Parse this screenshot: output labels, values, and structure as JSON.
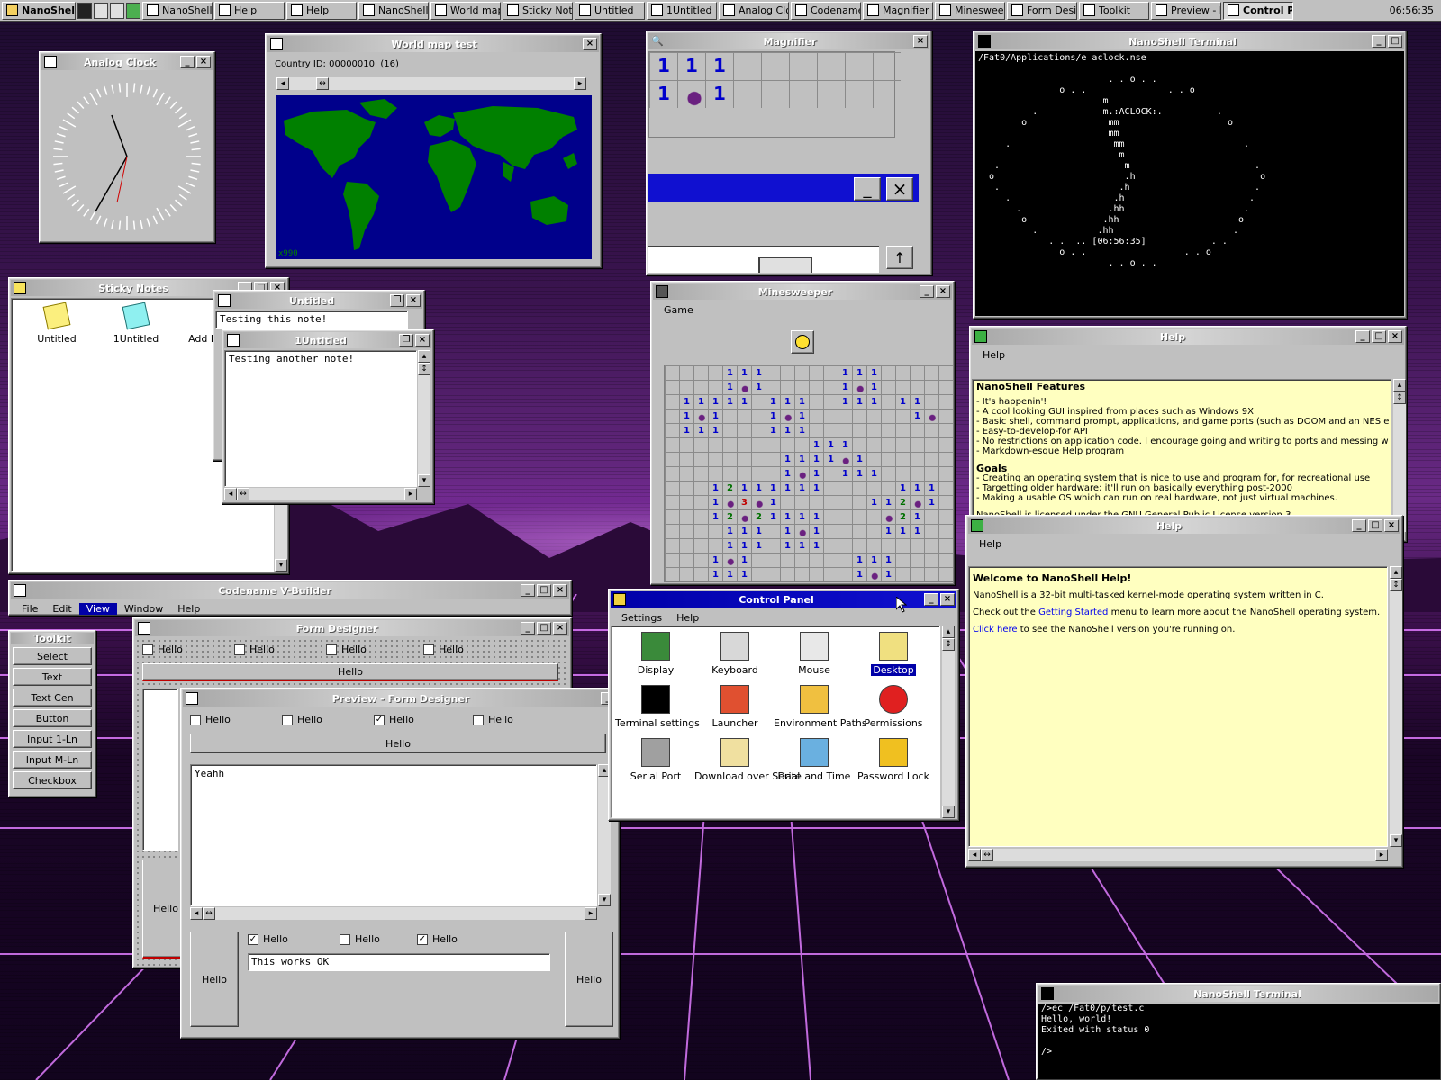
{
  "taskbar": {
    "start_label": "NanoShell",
    "buttons": [
      "NanoShell",
      "Help",
      "Help",
      "NanoShell",
      "World map",
      "Sticky Note",
      "Untitled",
      "1Untitled",
      "Analog Clo",
      "Codename",
      "Magnifier",
      "Minesweep",
      "Form Desig",
      "Toolkit",
      "Preview - F",
      "Control P"
    ],
    "clock": "06:56:35"
  },
  "analog_clock": {
    "title": "Analog Clock"
  },
  "world_map": {
    "title": "World map test",
    "country_id": "Country ID: 00000010  (16)",
    "corner_label": "x990"
  },
  "magnifier": {
    "title": "Magnifier",
    "cells": [
      "1",
      "1",
      "1",
      "1",
      "1"
    ]
  },
  "terminal1": {
    "title": "NanoShell Terminal",
    "lines": [
      "/Fat0/Applications/e aclock.nse",
      "",
      "                        . . o . .",
      "               o . .               . . o",
      "                       m",
      "          .            m.:ACLOCK:.          .",
      "        o               mm                    o",
      "                        mm",
      "     .                   mm                      .",
      "                          m",
      "   .                       m                       .",
      "  o                        .h                       o",
      "   .                      .h                       .",
      "     .                   .h                       .",
      "       .                .hh                      .",
      "        o              .hh                      o",
      "          .           .hh                      .",
      "             . .  .. [06:56:35]            . .",
      "               o . .                  . . o",
      "                        . . o . ."
    ]
  },
  "help1": {
    "title": "Help",
    "menu": "Help",
    "heading": "NanoShell Features",
    "features": [
      "- It's happenin'!",
      "- A cool looking GUI inspired from places such as Windows 9X",
      "- Basic shell, command prompt, applications, and game ports (such as DOOM and an NES e",
      "- Easy-to-develop-for API",
      "- No restrictions on application code.  I encourage going and writing to ports and messing w",
      "- Markdown-esque Help program"
    ],
    "goals_heading": "Goals",
    "goals": [
      "- Creating an operating system that is nice to use and program for, for recreational use",
      "- Targetting older hardware; it'll run on basically everything post-2000",
      "- Making a usable OS which can run on real hardware, not just virtual machines."
    ],
    "license": "NanoShell is licensed under the GNU General Public License version 3."
  },
  "help2": {
    "title": "Help",
    "menu": "Help",
    "heading": "Welcome to NanoShell Help!",
    "p1": "NanoShell is a 32-bit multi-tasked kernel-mode operating system written in C.",
    "p2_pre": "Check out the ",
    "p2_link": "Getting Started",
    "p2_post": " menu to learn more about the NanoShell operating system.",
    "p3_link": "Click here",
    "p3_post": " to see the NanoShell version you're running on."
  },
  "sticky": {
    "title": "Sticky Notes",
    "items": [
      "Untitled",
      "1Untitled",
      "Add Ne"
    ]
  },
  "note1": {
    "title": "Untitled",
    "text": "Testing this note!"
  },
  "note2": {
    "title": "1Untitled",
    "text": "Testing another note!"
  },
  "minesweeper": {
    "title": "Minesweeper",
    "menu": "Game"
  },
  "vbuilder": {
    "title": "Codename V-Builder",
    "menu": [
      "File",
      "Edit",
      "View",
      "Window",
      "Help"
    ]
  },
  "toolkit": {
    "title": "Toolkit",
    "tools": [
      "Select",
      "Text",
      "Text Cen",
      "Button",
      "Input 1-Ln",
      "Input M-Ln",
      "Checkbox"
    ]
  },
  "form_designer": {
    "title": "Form Designer",
    "checks": [
      "Hello",
      "Hello",
      "Hello",
      "Hello"
    ],
    "button": "Hello",
    "side_button": "Hello"
  },
  "preview": {
    "title": "Preview - Form Designer",
    "checks": [
      "Hello",
      "Hello",
      "Hello",
      "Hello"
    ],
    "button": "Hello",
    "textarea": "Yeahh",
    "bottom_checks": [
      "Hello",
      "Hello",
      "Hello"
    ],
    "input": "This works OK",
    "left_button": "Hello",
    "right_button": "Hello"
  },
  "control_panel": {
    "title": "Control Panel",
    "menu": [
      "Settings",
      "Help"
    ],
    "items": [
      "Display",
      "Keyboard",
      "Mouse",
      "Desktop",
      "Terminal settings",
      "Launcher",
      "Environment Paths",
      "Permissions",
      "Serial Port",
      "Download over Serial",
      "Date and Time",
      "Password Lock"
    ]
  },
  "terminal2": {
    "title": "NanoShell Terminal",
    "lines": [
      "/>ec /Fat0/p/test.c",
      "Hello, world!",
      "Exited with status 0",
      "",
      "/>"
    ]
  },
  "colors": {
    "title_active": "#0000a8",
    "help_bg": "#ffffc0",
    "map_sea": "#00008b",
    "map_land": "#008000"
  }
}
